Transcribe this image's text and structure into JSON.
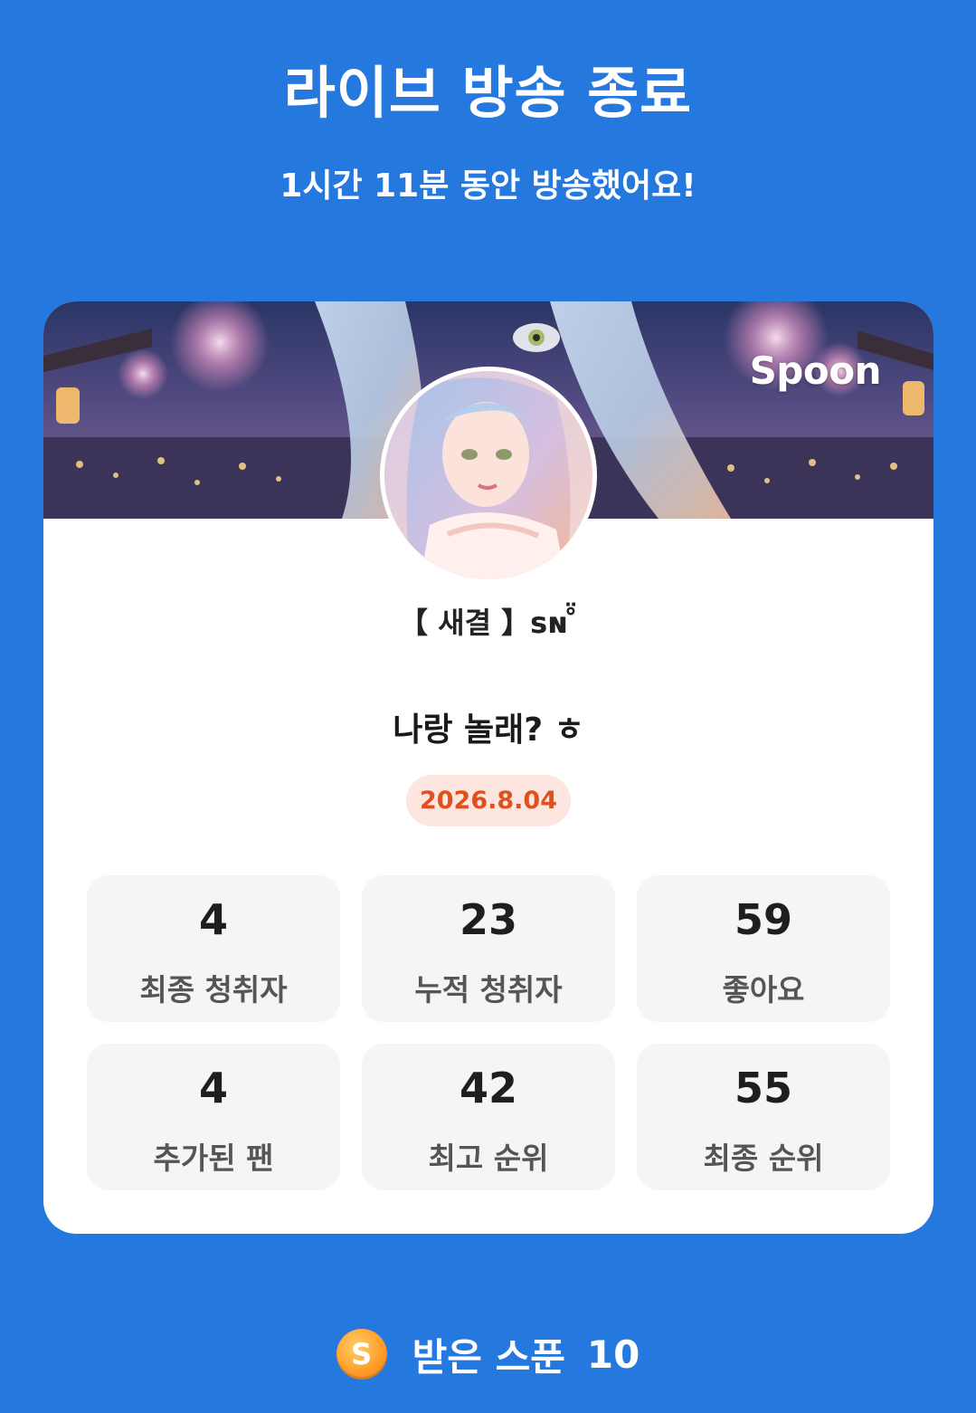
{
  "header": {
    "title": "라이브 방송 종료",
    "subtitle": "1시간 11분 동안 방송했어요!"
  },
  "card": {
    "brand": "Spoon",
    "dj_name": "【 새결 】sɴ ̊̈",
    "live_title": "나랑 놀래? ㅎ",
    "date": "2026.8.04",
    "stats": [
      {
        "value": "4",
        "label": "최종 청취자"
      },
      {
        "value": "23",
        "label": "누적 청취자"
      },
      {
        "value": "59",
        "label": "좋아요"
      },
      {
        "value": "4",
        "label": "추가된 팬"
      },
      {
        "value": "42",
        "label": "최고 순위"
      },
      {
        "value": "55",
        "label": "최종 순위"
      }
    ]
  },
  "footer": {
    "spoon_icon_letter": "S",
    "received_label": "받은 스푼",
    "received_count": "10"
  },
  "colors": {
    "background": "#2478de",
    "card": "#ffffff",
    "badge_bg": "#fde6e0",
    "badge_text": "#e0501f",
    "stat_bg": "#f5f5f5"
  }
}
